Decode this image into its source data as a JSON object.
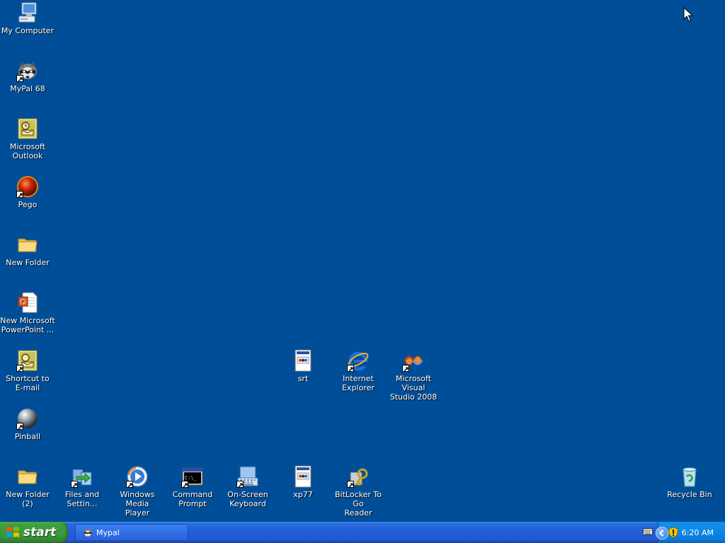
{
  "desktop": {
    "icons": [
      {
        "label": "My Computer",
        "icon": "my-computer-icon"
      },
      {
        "label": "MyPal 68",
        "icon": "mypal-icon"
      },
      {
        "label": "Microsoft\nOutlook",
        "icon": "outlook-icon"
      },
      {
        "label": "Pego",
        "icon": "pego-icon"
      },
      {
        "label": "New Folder",
        "icon": "folder-icon"
      },
      {
        "label": "New Microsoft\nPowerPoint ...",
        "icon": "powerpoint-icon"
      },
      {
        "label": "Shortcut to\nE-mail",
        "icon": "email-shortcut-icon"
      },
      {
        "label": "Pinball",
        "icon": "pinball-icon"
      },
      {
        "label": "New Folder (2)",
        "icon": "folder-icon"
      },
      {
        "label": "Files and\nSettin...",
        "icon": "files-settings-icon"
      },
      {
        "label": "Windows Media\nPlayer",
        "icon": "media-player-icon"
      },
      {
        "label": "Command\nPrompt",
        "icon": "command-prompt-icon"
      },
      {
        "label": "On-Screen\nKeyboard",
        "icon": "onscreen-keyboard-icon"
      },
      {
        "label": "xp77",
        "icon": "document-icon"
      },
      {
        "label": "BitLocker To Go\nReader",
        "icon": "bitlocker-icon"
      },
      {
        "label": "srt",
        "icon": "document-icon"
      },
      {
        "label": "Internet\nExplorer",
        "icon": "internet-explorer-icon"
      },
      {
        "label": "Microsoft Visual\nStudio 2008",
        "icon": "visual-studio-icon"
      },
      {
        "label": "Recycle Bin",
        "icon": "recycle-bin-icon"
      }
    ]
  },
  "taskbar": {
    "start_label": "start",
    "tasks": [
      {
        "label": "Mypal"
      }
    ],
    "clock": "6:20 AM"
  },
  "colors": {
    "desktop_background": "#004e98",
    "taskbar_blue": "#245edb",
    "start_green": "#3a9a3a",
    "tray_blue": "#0c8ae8"
  }
}
